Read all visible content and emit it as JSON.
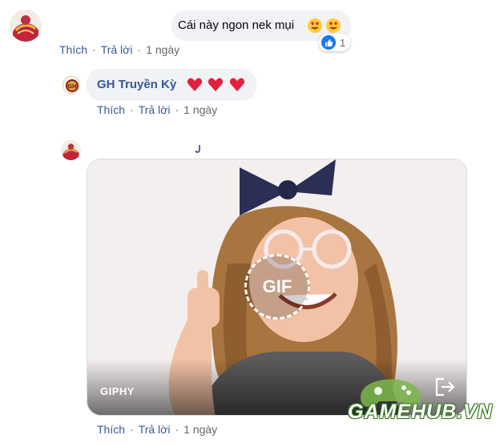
{
  "comment1": {
    "text": "Cái này ngon nek mụi",
    "reaction_count": "1",
    "emoji": "heart-eyes-emoji"
  },
  "comment1_actions": {
    "like": "Thích",
    "reply": "Trả lời",
    "time": "1 ngày",
    "sep": "·"
  },
  "reply1": {
    "author": "GH Truyền Kỳ",
    "emoji": "red-heart-emoji"
  },
  "reply1_actions": {
    "like": "Thích",
    "reply": "Trả lời",
    "time": "1 ngày",
    "sep": "·"
  },
  "reply2": {
    "gif_badge": "GIF",
    "gif_source": "GIPHY",
    "share_icon": "share-out-icon"
  },
  "reply2_actions": {
    "like": "Thích",
    "reply": "Trả lời",
    "time": "1 ngày",
    "sep": "·"
  },
  "watermark": {
    "text": "GAMEHUB.VN"
  },
  "colors": {
    "link": "#385898",
    "meta": "#65676b",
    "bubble": "#f0f2f5",
    "like_blue": "#1877f2",
    "heart_red": "#e41e3f"
  }
}
